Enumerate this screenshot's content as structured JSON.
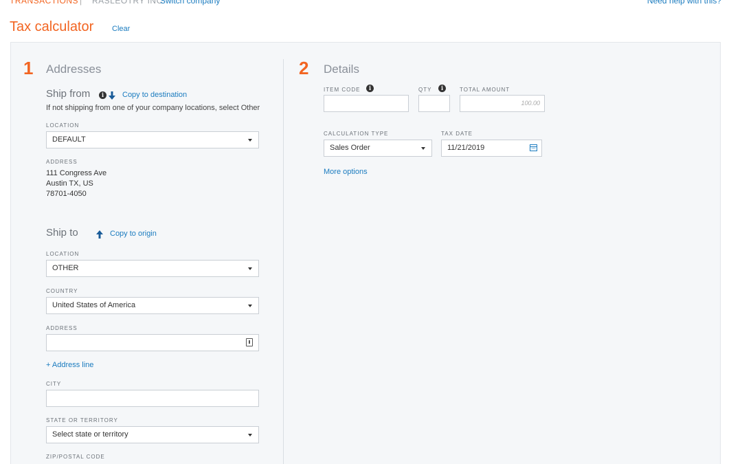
{
  "topbar": {
    "breadcrumb": "TRANSACTIONS",
    "separator": "|",
    "company": "RASLEOTRY INC",
    "switch_company": "Switch company",
    "help": "Need help with this?"
  },
  "page": {
    "title": "Tax calculator",
    "clear": "Clear"
  },
  "addresses": {
    "step": "1",
    "title": "Addresses",
    "ship_from": {
      "title": "Ship from",
      "copy_link": "Copy to destination",
      "hint": "If not shipping from one of your company locations, select Other",
      "location_label": "LOCATION",
      "location_value": "DEFAULT",
      "address_label": "ADDRESS",
      "address_line1": "111 Congress Ave",
      "address_line2": "Austin TX, US",
      "address_line3": "78701-4050"
    },
    "ship_to": {
      "title": "Ship to",
      "copy_link": "Copy to origin",
      "location_label": "LOCATION",
      "location_value": "OTHER",
      "country_label": "COUNTRY",
      "country_value": "United States of America",
      "address_label": "ADDRESS",
      "address_value": "",
      "add_line": "+ Address line",
      "city_label": "CITY",
      "city_value": "",
      "state_label": "STATE OR TERRITORY",
      "state_value": "Select state or territory",
      "zip_label": "ZIP/POSTAL CODE"
    }
  },
  "details": {
    "step": "2",
    "title": "Details",
    "item_code_label": "ITEM CODE",
    "item_code_value": "",
    "qty_label": "QTY",
    "qty_value": "",
    "total_label": "TOTAL AMOUNT",
    "total_placeholder": "100.00",
    "calc_type_label": "CALCULATION TYPE",
    "calc_type_value": "Sales Order",
    "tax_date_label": "TAX DATE",
    "tax_date_value": "11/21/2019",
    "more_options": "More options"
  },
  "colors": {
    "accent": "#f26522",
    "link": "#1a7bbf",
    "panel": "#f5f7f9"
  }
}
